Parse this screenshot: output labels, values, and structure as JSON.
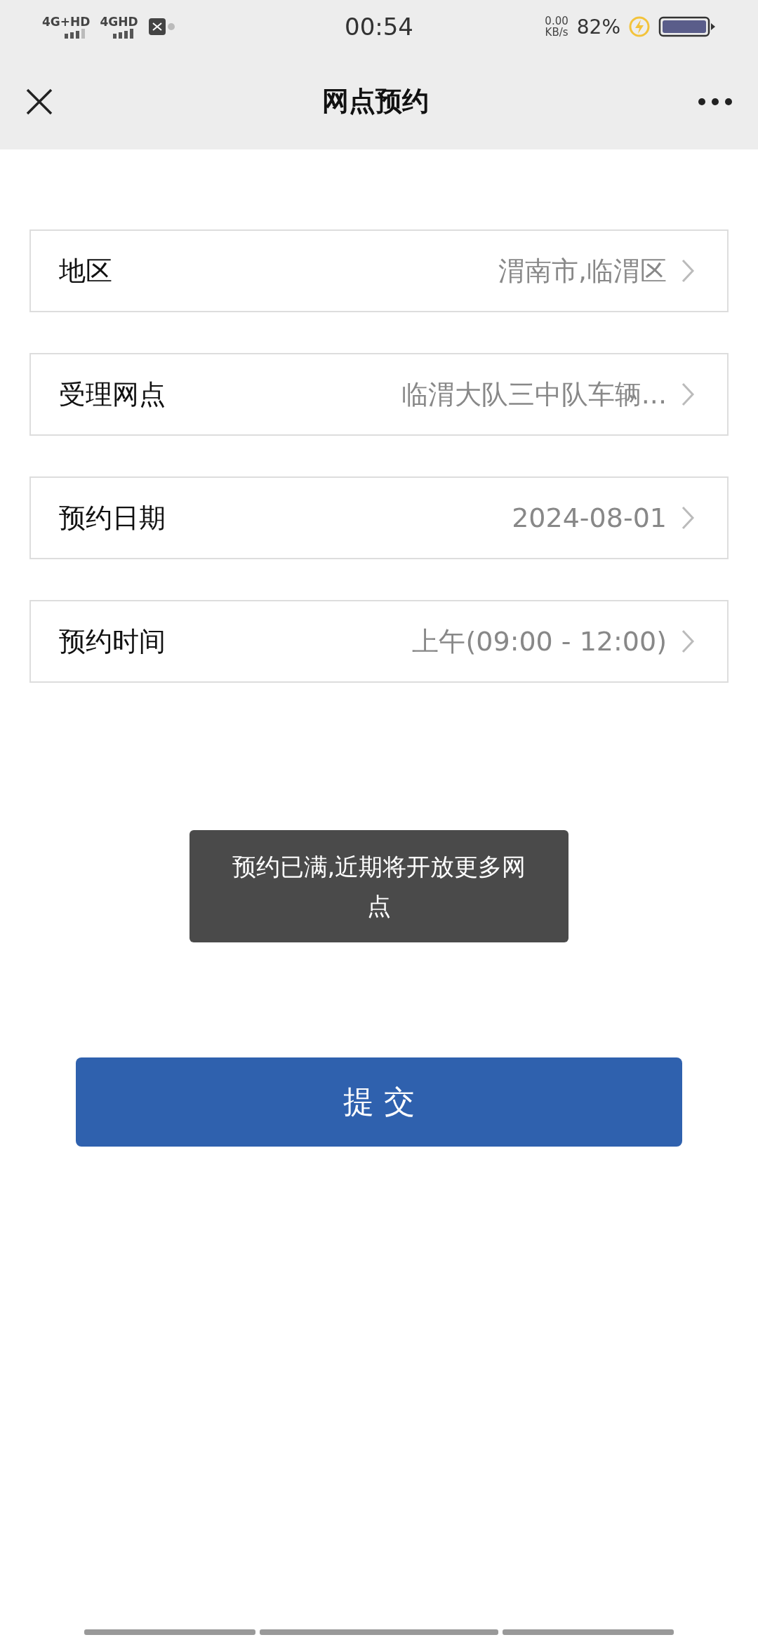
{
  "status_bar": {
    "sim_1": "4G+HD",
    "sim_2": "4GHD",
    "time": "00:54",
    "net_speed": "0.00",
    "net_unit": "KB/s",
    "battery": "82%",
    "charging": true
  },
  "nav": {
    "title": "网点预约"
  },
  "fields": [
    {
      "label": "地区",
      "value": "渭南市,临渭区"
    },
    {
      "label": "受理网点",
      "value": "临渭大队三中队车辆..."
    },
    {
      "label": "预约日期",
      "value": "2024-08-01"
    },
    {
      "label": "预约时间",
      "value": "上午(09:00 - 12:00)"
    }
  ],
  "toast": "预约已满,近期将开放更多网点",
  "submit": "提 交"
}
